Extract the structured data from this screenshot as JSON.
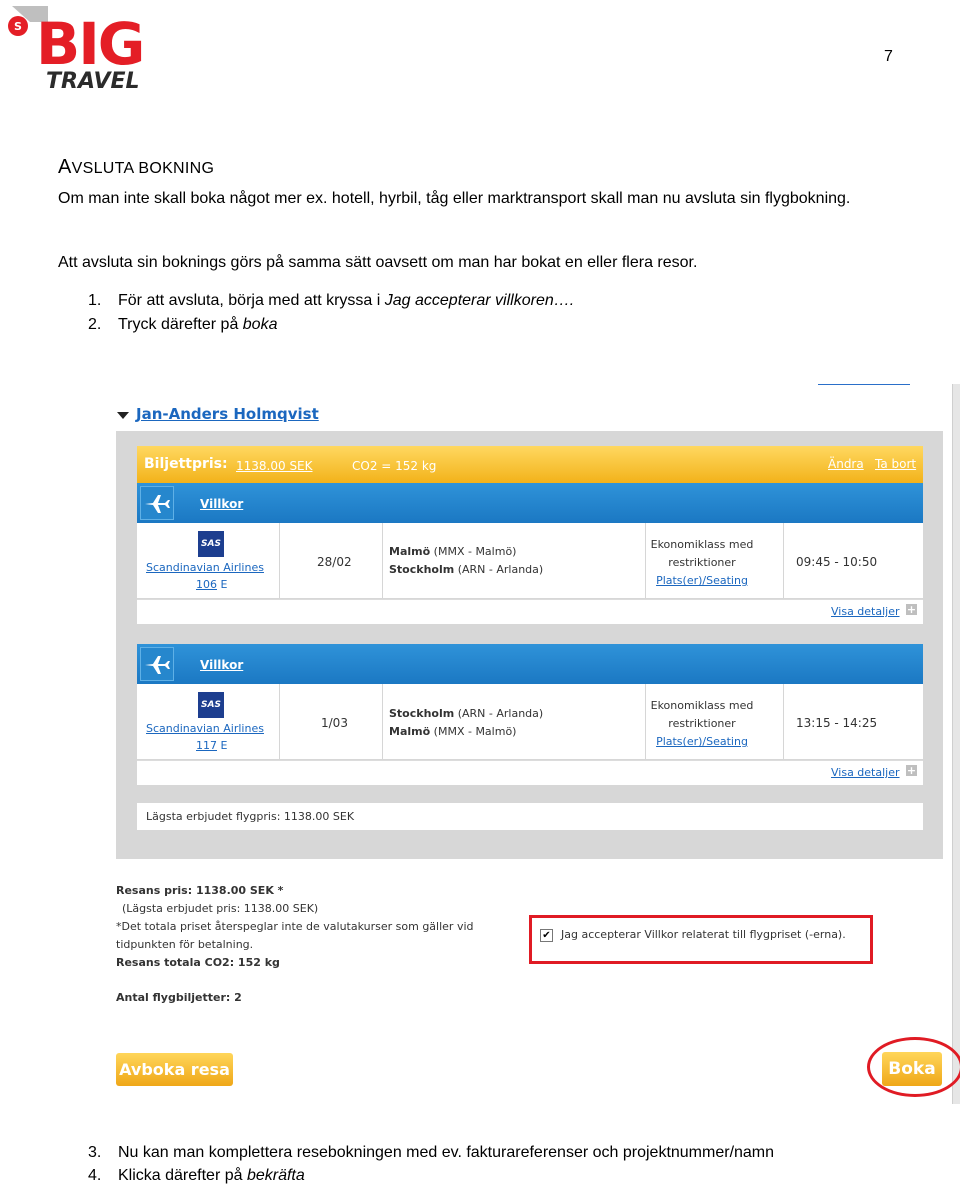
{
  "logo": {
    "big": "BIG",
    "travel": "TRAVEL",
    "mark": "S"
  },
  "page_number": "7",
  "doc": {
    "heading_first": "A",
    "heading_rest": "VSLUTA BOKNING",
    "p1": "Om man inte skall boka något mer ex. hotell, hyrbil, tåg eller marktransport skall man nu avsluta sin flygbokning.",
    "p2": "Att avsluta sin boknings görs på samma sätt oavsett om man har bokat en eller flera resor.",
    "steps": [
      {
        "num": "1.",
        "text": "För att avsluta, börja med att kryssa i ",
        "em": "Jag accepterar villkoren…."
      },
      {
        "num": "2.",
        "text": "Tryck därefter på ",
        "em": "boka"
      },
      {
        "num": "3.",
        "text": "Nu kan man komplettera resebokningen med ev. fakturareferenser och projektnummer/namn",
        "em": ""
      },
      {
        "num": "4.",
        "text": "Klicka därefter på ",
        "em": "bekräfta"
      }
    ]
  },
  "booking": {
    "traveler_name": "Jan-Anders Holmqvist",
    "price_label": "Biljettpris:",
    "price_value": "1138.00 SEK",
    "co2": "CO2 = 152 kg",
    "link_change": "Ändra",
    "link_remove": "Ta bort",
    "flights": [
      {
        "villkor": "Villkor",
        "logo": "SAS",
        "airline": "Scandinavian Airlines",
        "flight_no": "106",
        "fare_code": "E",
        "date": "28/02",
        "from": "Malmö",
        "from_detail": "(MMX - Malmö)",
        "to": "Stockholm",
        "to_detail": "(ARN - Arlanda)",
        "class_line1": "Ekonomiklass med",
        "class_line2": "restriktioner",
        "seating": "Plats(er)/Seating",
        "time": "09:45 - 10:50",
        "details": "Visa detaljer"
      },
      {
        "villkor": "Villkor",
        "logo": "SAS",
        "airline": "Scandinavian Airlines",
        "flight_no": "117",
        "fare_code": "E",
        "date": "1/03",
        "from": "Stockholm",
        "from_detail": "(ARN - Arlanda)",
        "to": "Malmö",
        "to_detail": "(MMX - Malmö)",
        "class_line1": "Ekonomiklass med",
        "class_line2": "restriktioner",
        "seating": "Plats(er)/Seating",
        "time": "13:15 - 14:25",
        "details": "Visa detaljer"
      }
    ],
    "lowest_fare": "Lägsta erbjudet flygpris: 1138.00 SEK",
    "summary": {
      "trip_price": "Resans pris: 1138.00 SEK *",
      "lowest": "(Lägsta erbjudet pris: 1138.00 SEK)",
      "note1": "*Det totala priset återspeglar inte de valutakurser som gäller vid",
      "note2": "tidpunkten för betalning.",
      "co2_total": "Resans totala CO2: 152 kg"
    },
    "accept_label": "Jag accepterar Villkor relaterat till flygpriset (-erna).",
    "accept_checked": "✔",
    "ticket_count": "Antal flygbiljetter: 2",
    "cancel_button": "Avboka resa",
    "book_button": "Boka"
  },
  "colors": {
    "logo_red": "#e41e26",
    "logo_dark": "#2b2b2b",
    "highlight_red": "#e01b24",
    "brand_blue": "#1b78c3",
    "brand_yellow": "#f2b21a"
  }
}
